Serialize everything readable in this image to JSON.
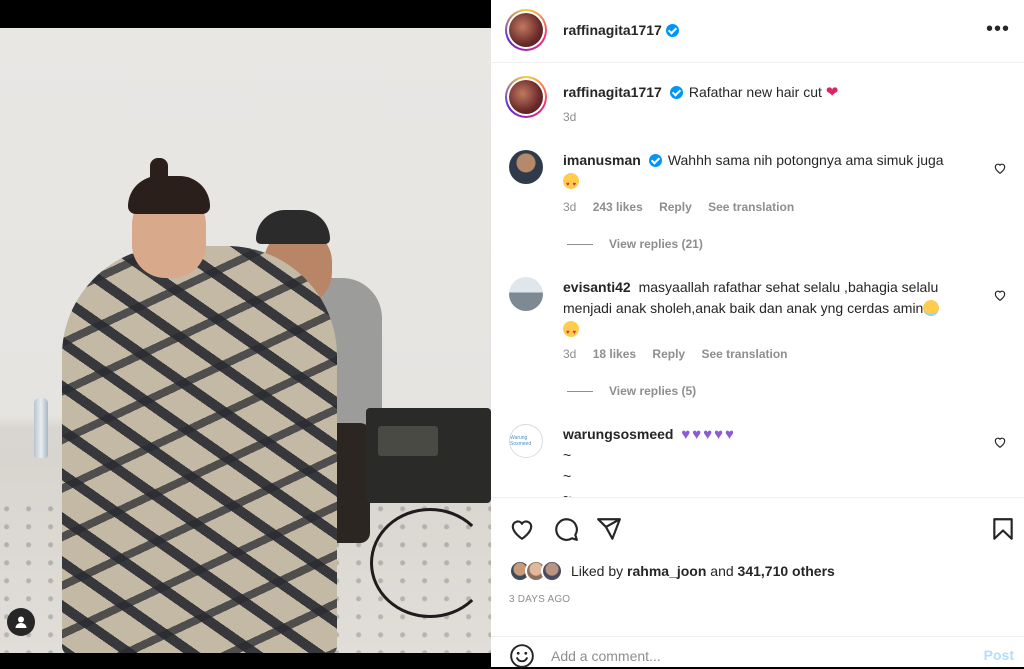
{
  "post": {
    "author": "raffinagita1717",
    "caption": "Rafathar new hair cut",
    "caption_time": "3d"
  },
  "comments": [
    {
      "user": "imanusman",
      "verified": true,
      "text": "Wahhh sama nih potongnya ama simuk juga",
      "time": "3d",
      "likes": "243 likes",
      "reply": "Reply",
      "translate": "See translation",
      "view_replies": "View replies (21)"
    },
    {
      "user": "evisanti42",
      "verified": false,
      "text": "masyaallah rafathar sehat selalu ,bahagia selalu menjadi anak sholeh,anak baik dan anak yng cerdas amin",
      "time": "3d",
      "likes": "18 likes",
      "reply": "Reply",
      "translate": "See translation",
      "view_replies": "View replies (5)"
    },
    {
      "user": "warungsosmeed",
      "verified": false,
      "text": "",
      "line2": "~",
      "line3": "~",
      "line4": "~"
    }
  ],
  "likes_summary": {
    "prefix": "Liked by",
    "user": "rahma_joon",
    "and": "and",
    "others": "341,710 others"
  },
  "date": "3 DAYS AGO",
  "comment_box": {
    "placeholder": "Add a comment...",
    "post_label": "Post"
  },
  "icons": [
    "heart-icon",
    "comment-icon",
    "share-icon",
    "bookmark-icon",
    "emoji-icon",
    "more-icon",
    "user-tag-icon"
  ],
  "colors": {
    "link_disabled": "#b2dffc",
    "verified": "#0095f6",
    "like_red": "#e0245e"
  }
}
